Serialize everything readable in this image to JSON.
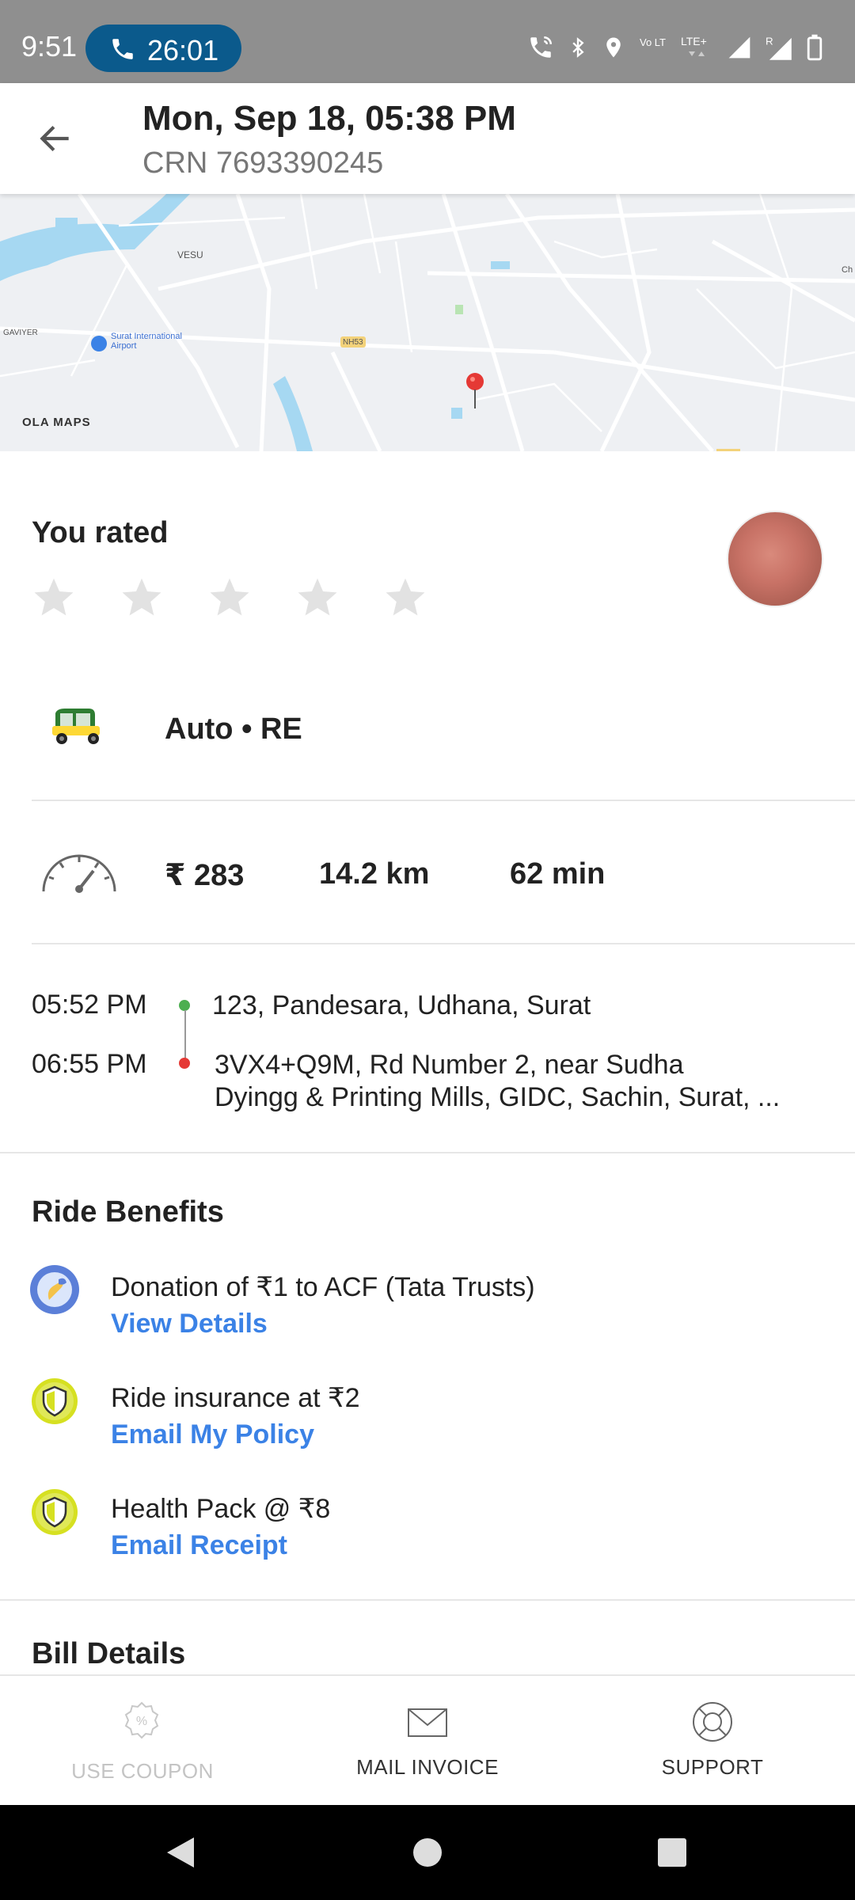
{
  "status_bar": {
    "time": "9:51",
    "call_duration": "26:01",
    "icons": [
      "wifi-calling-icon",
      "bluetooth-icon",
      "location-icon",
      "volte-icon",
      "lte-plus-icon",
      "signal-icon",
      "signal-roaming-icon",
      "battery-icon"
    ],
    "volte_text": "Vo LTE",
    "lte_text": "LTE+",
    "roaming_text": "R"
  },
  "header": {
    "title": "Mon, Sep 18, 05:38 PM",
    "subtitle": "CRN 7693390245"
  },
  "map": {
    "labels": {
      "vesu": "VESU",
      "gaviyer": "GAVIYER",
      "airport": "Surat International Airport",
      "nh": "NH53",
      "ch": "Ch"
    },
    "brand": "OLA MAPS"
  },
  "rating": {
    "label": "You rated",
    "stars_total": 5,
    "stars_filled": 0
  },
  "vehicle": {
    "label": "Auto • RE"
  },
  "stats": {
    "fare": "₹ 283",
    "distance": "14.2 km",
    "duration": "62 min"
  },
  "trip": {
    "pickup_time": "05:52 PM",
    "pickup_address": "123, Pandesara, Udhana, Surat",
    "drop_time": "06:55 PM",
    "drop_address_line1": "3VX4+Q9M, Rd Number 2, near Sudha",
    "drop_address_line2": "Dyingg & Printing Mills, GIDC, Sachin, Surat, ..."
  },
  "benefits": {
    "title": "Ride Benefits",
    "items": [
      {
        "text": "Donation of ₹1 to ACF (Tata Trusts)",
        "link": "View Details",
        "icon": "donation-icon"
      },
      {
        "text": "Ride insurance at ₹2",
        "link": "Email My Policy",
        "icon": "shield-icon"
      },
      {
        "text": "Health Pack @ ₹8",
        "link": "Email Receipt",
        "icon": "shield-icon"
      }
    ]
  },
  "bill": {
    "title": "Bill Details"
  },
  "actions": {
    "coupon": "USE COUPON",
    "invoice": "MAIL INVOICE",
    "support": "SUPPORT"
  },
  "colors": {
    "link": "#3b82e6",
    "pickup_dot": "#4caf50",
    "drop_dot": "#e53935",
    "status_bar": "#8f8f8f",
    "call_pill": "#0b5a8c"
  }
}
